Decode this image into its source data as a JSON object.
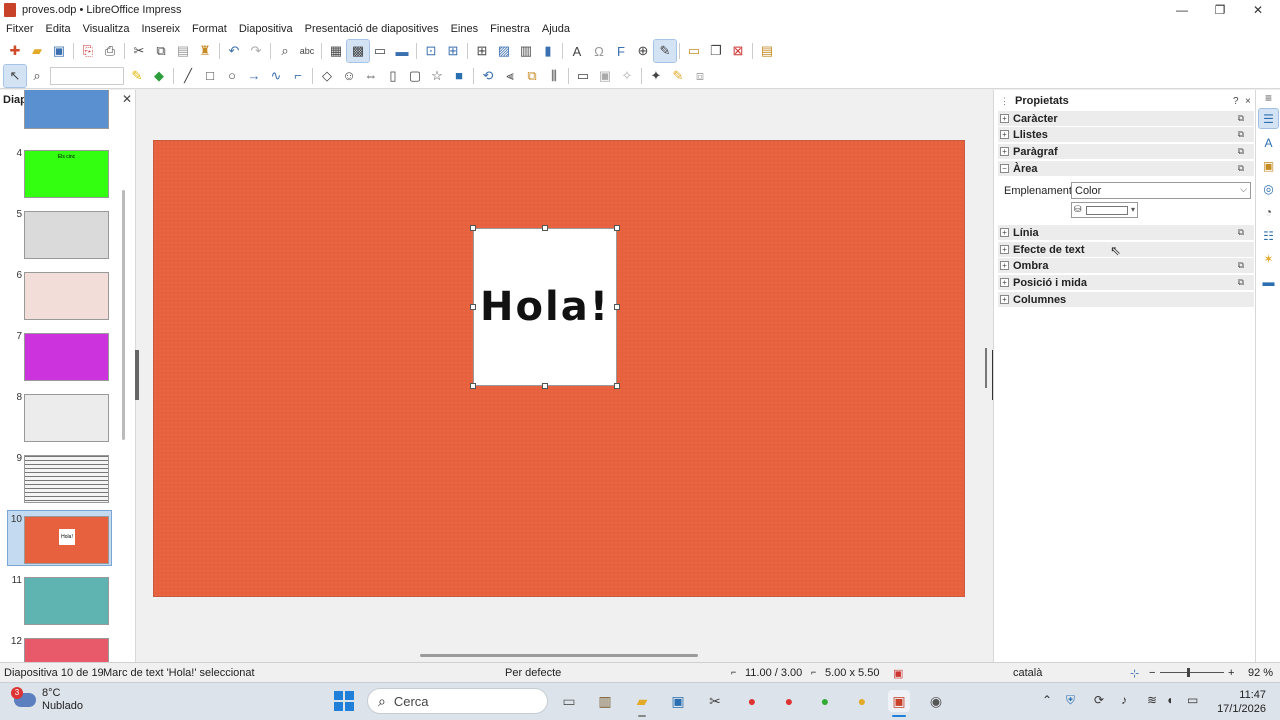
{
  "window": {
    "title": "proves.odp • LibreOffice Impress"
  },
  "menu": [
    "Fitxer",
    "Edita",
    "Visualitza",
    "Insereix",
    "Format",
    "Diapositiva",
    "Presentació de diapositives",
    "Eines",
    "Finestra",
    "Ajuda"
  ],
  "slides_panel": {
    "title": "Diapositives",
    "slides": [
      {
        "num": "",
        "bg": "#5a8fd0"
      },
      {
        "num": "4",
        "bg": "#33ff11",
        "caption": "Els cinc"
      },
      {
        "num": "5",
        "bg": "#dadada"
      },
      {
        "num": "6",
        "bg": "#f3ddd8"
      },
      {
        "num": "7",
        "bg": "#cc33dd"
      },
      {
        "num": "8",
        "bg": "#ececec"
      },
      {
        "num": "9",
        "bg": "#f4f4f4"
      },
      {
        "num": "10",
        "bg": "#e8613f",
        "caption": "Hola!"
      },
      {
        "num": "11",
        "bg": "#5fb3b0"
      },
      {
        "num": "12",
        "bg": "#e85a6a"
      }
    ],
    "selected_slide": "10"
  },
  "slide": {
    "text": "Hola!",
    "bg_color": "#e8613f"
  },
  "properties": {
    "title": "Propietats",
    "help": "?",
    "close": "×",
    "menu": "≡",
    "sections": [
      {
        "label": "Caràcter",
        "expanded": false,
        "more": true
      },
      {
        "label": "Llistes",
        "expanded": false,
        "more": true
      },
      {
        "label": "Paràgraf",
        "expanded": false,
        "more": true
      },
      {
        "label": "Àrea",
        "expanded": true,
        "more": true
      },
      {
        "label": "Línia",
        "expanded": false,
        "more": true
      },
      {
        "label": "Efecte de text",
        "expanded": false,
        "more": false
      },
      {
        "label": "Ombra",
        "expanded": false,
        "more": true
      },
      {
        "label": "Posició i mida",
        "expanded": false,
        "more": true
      },
      {
        "label": "Columnes",
        "expanded": false,
        "more": false
      }
    ],
    "area": {
      "fill_label": "Emplenament:",
      "fill_value": "Color",
      "color": "#ffffff"
    }
  },
  "status": {
    "slide": "Diapositiva 10 de 19",
    "selection": "Marc de text 'Hola!' seleccionat",
    "master": "Per defecte",
    "position": "11.00 / 3.00",
    "size": "5.00 x 5.50",
    "language": "català",
    "zoom": "92 %"
  },
  "taskbar": {
    "weather_temp": "8°C",
    "weather_desc": "Nublado",
    "weather_badge": "3",
    "search_placeholder": "Cerca",
    "time": "11:47",
    "date": "17/1/2026"
  }
}
